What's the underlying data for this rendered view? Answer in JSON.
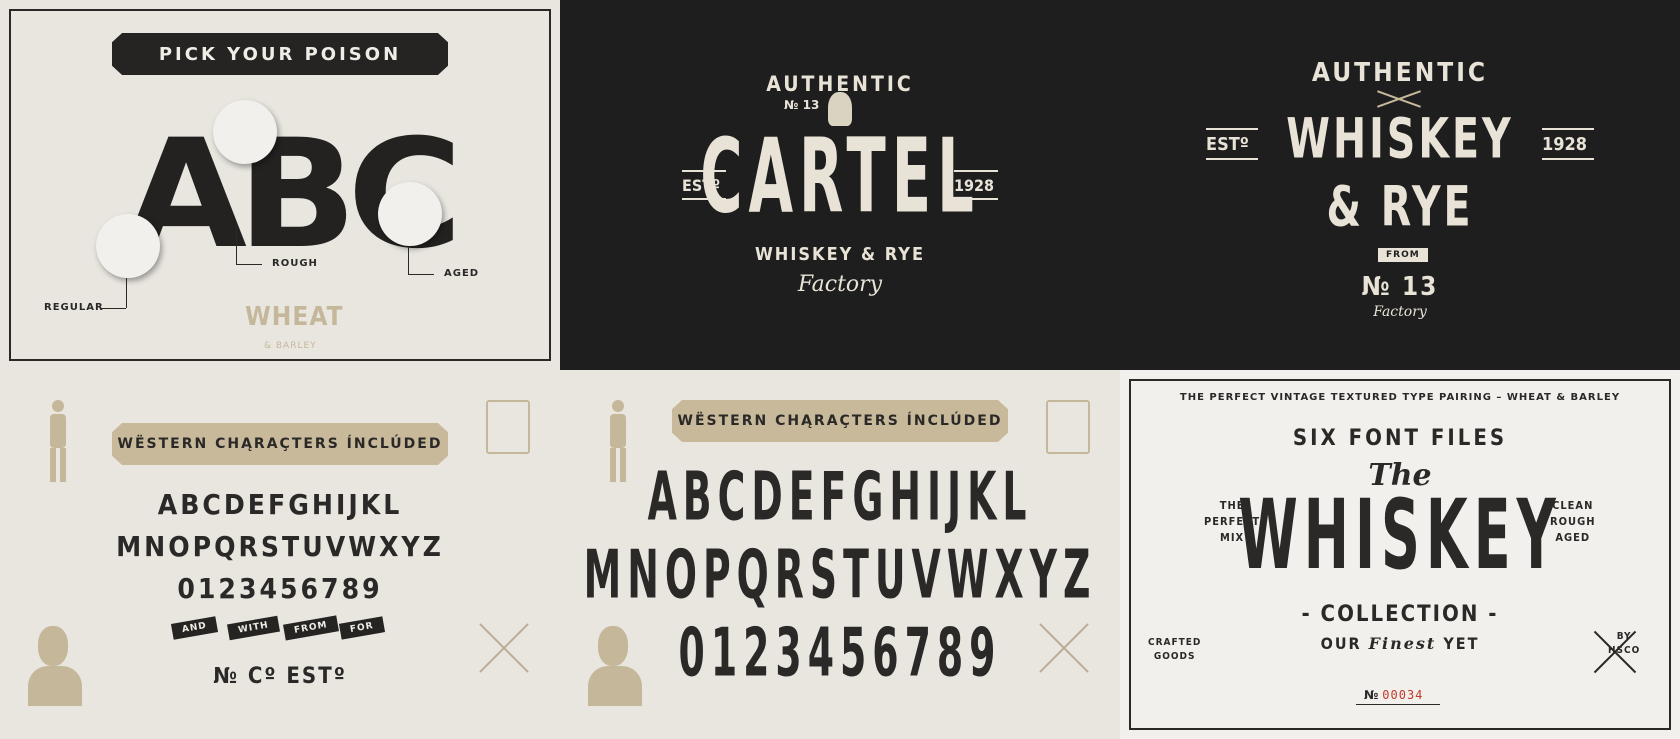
{
  "p1": {
    "banner": "PICK YOUR POISON",
    "letters": [
      "A",
      "B",
      "C"
    ],
    "labels": {
      "regular": "REGULAR",
      "rough": "ROUGH",
      "aged": "AGED"
    },
    "logo_main": "WHEAT",
    "logo_sub": "& BARLEY"
  },
  "p2": {
    "arc": "AUTHENTIC",
    "no": "№ 13",
    "title": "CARTEL",
    "estd": "ESTº",
    "year": "1928",
    "line1": "WHISKEY & RYE",
    "script": "Factory"
  },
  "p3": {
    "arc": "AUTHENTIC",
    "estd": "ESTº",
    "year": "1928",
    "title1": "WHISKEY",
    "title2": "& RYE",
    "ribbon": "FROM",
    "no": "№ 13",
    "script": "Factory"
  },
  "p4": {
    "banner": "WËSTERN CHĄRAÇTERS ÍNCLÚDED",
    "row1": "ABCDEFGHIJKL",
    "row2": "MNOPQRSTUVWXYZ",
    "row3": "0123456789",
    "ribbons": [
      "AND",
      "WITH",
      "FROM",
      "FOR"
    ],
    "extras": "№ Cº ESTº"
  },
  "p5": {
    "banner": "WËSTERN CHĄRAÇTERS ÍNCLÚDED",
    "row1": "ABCDEFGHIJKL",
    "row2": "MNOPQRSTUVWXYZ",
    "row3": "0123456789"
  },
  "p6": {
    "top": "THE PERFECT VINTAGE TEXTURED TYPE PAIRING – WHEAT & BARLEY",
    "arc": "SIX FONT FILES",
    "the": "The",
    "title": "WHISKEY",
    "collection": "- COLLECTION -",
    "our": "OUR",
    "finest": "Finest",
    "yet": "YET",
    "left": [
      "THE",
      "PERFECT",
      "MIX"
    ],
    "right": [
      "CLEAN",
      "ROUGH",
      "AGED"
    ],
    "crafted": [
      "CRAFTED",
      "GOODS"
    ],
    "by": [
      "BY",
      "HSCO"
    ],
    "serial_no": "№",
    "serial": "00034"
  },
  "colors": {
    "dark": "#1e1e1e",
    "cream": "#e9e6e0",
    "tan": "#c8b99a",
    "ink": "#2a2928",
    "serial_red": "#c0392b"
  }
}
